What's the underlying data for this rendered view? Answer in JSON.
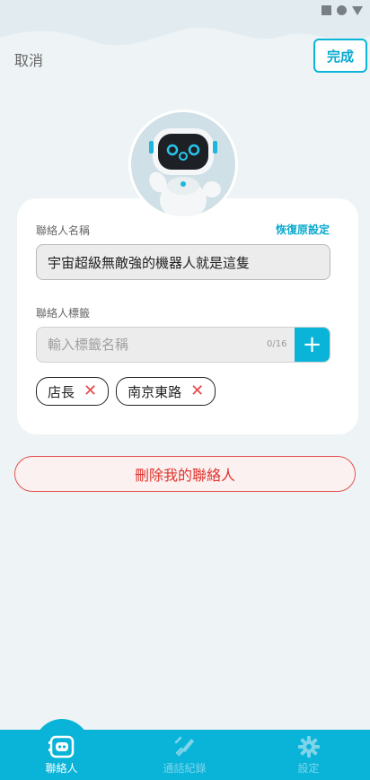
{
  "header": {
    "cancel_label": "取消",
    "done_label": "完成"
  },
  "contact": {
    "name_label": "聯絡人名稱",
    "restore_label": "恢復原設定",
    "name_value": "宇宙超級無敵強的機器人就是這隻",
    "tags_label": "聯絡人標籤",
    "tag_placeholder": "輸入標籤名稱",
    "tag_counter": "0/16",
    "add_label": "+",
    "tags": [
      "店長",
      "南京東路"
    ]
  },
  "delete_label": "刪除我的聯絡人",
  "tabbar": {
    "tabs": [
      {
        "label": "聯絡人",
        "icon": "contacts-icon",
        "active": true
      },
      {
        "label": "通話紀錄",
        "icon": "call-log-icon",
        "active": false
      },
      {
        "label": "設定",
        "icon": "settings-icon",
        "active": false
      }
    ]
  },
  "colors": {
    "accent": "#0ab4d9",
    "danger": "#e0342e",
    "background": "#eef3f5"
  }
}
